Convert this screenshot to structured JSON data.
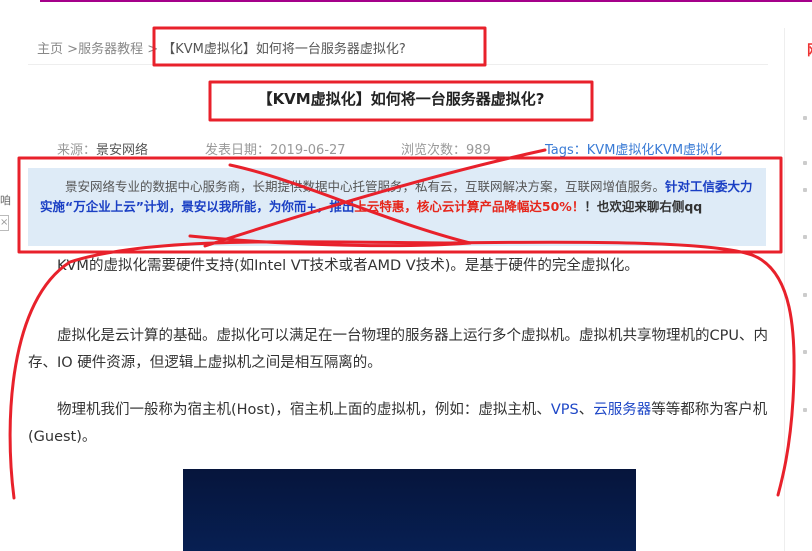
{
  "breadcrumb": {
    "home": "主页",
    "sep1": ">",
    "category": "服务器教程",
    "sep2": ">",
    "current": "【KVM虚拟化】如何将一台服务器虚拟化?"
  },
  "article": {
    "title": "【KVM虚拟化】如何将一台服务器虚拟化?",
    "meta": {
      "source_label": "来源：",
      "source": "景安网络",
      "date_label": "发表日期：",
      "date": "2019-06-27",
      "views_label": "浏览次数：",
      "views": "989",
      "tags_label": "Tags：",
      "tags": "KVM虚拟化KVM虚拟化"
    },
    "notice": {
      "text1": "景安网络专业的数据中心服务商，长期提供数据中心托管服务，私有云，互联网解决方案，互联网增值服务。",
      "text2": "针对工信委大力实施“万企业上云”计划，景安以我所能，为你而+，推出",
      "text3": "上云特惠，核心云计算产品降幅达50%！",
      "text4": "！也欢迎来聊右侧qq"
    },
    "paragraphs": {
      "p1": "KVM的虚拟化需要硬件支持(如Intel VT技术或者AMD V技术)。是基于硬件的完全虚拟化。",
      "p2": "虚拟化是云计算的基础。虚拟化可以满足在一台物理的服务器上运行多个虚拟机。虚拟机共享物理机的CPU、内存、IO 硬件资源，但逻辑上虚拟机之间是相互隔离的。",
      "p3_a": "物理机我们一般称为宿主机(Host)，宿主机上面的虚拟机，例如：虚拟主机、",
      "p3_link1": "VPS",
      "p3_sep": "、",
      "p3_link2": "云服务器",
      "p3_b": "等等都称为客户机(Guest)。"
    }
  },
  "sidebar": {
    "heading": "网"
  },
  "left_edge": {
    "glyph": "咱",
    "close": "×"
  },
  "colors": {
    "accent": "#a5008a",
    "annotation": "#e8212b",
    "notice_bg": "#deebf7",
    "link": "#1f48c7"
  }
}
